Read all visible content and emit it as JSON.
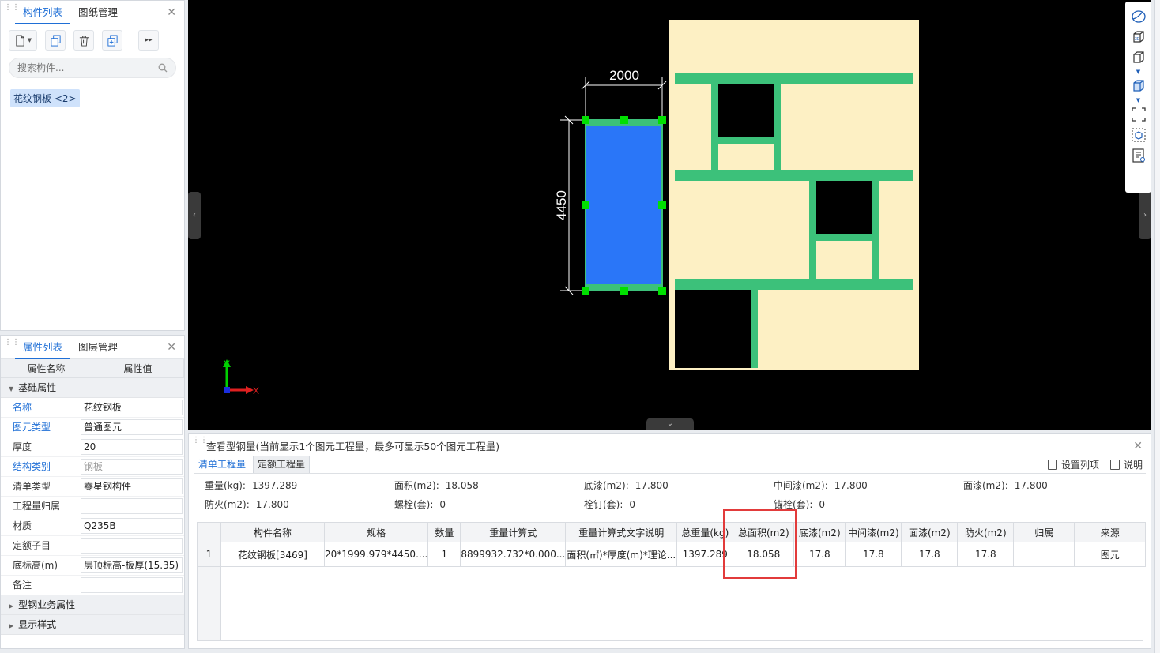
{
  "component_panel": {
    "tabs": [
      "构件列表",
      "图纸管理"
    ],
    "search_placeholder": "搜索构件...",
    "tag": "花纹钢板 <2>"
  },
  "property_panel": {
    "tabs": [
      "属性列表",
      "图层管理"
    ],
    "col_name": "属性名称",
    "col_value": "属性值",
    "group_basic": "基础属性",
    "rows": [
      {
        "k": "名称",
        "v": "花纹钢板"
      },
      {
        "k": "图元类型",
        "v": "普通图元"
      },
      {
        "k": "厚度",
        "v": "20"
      },
      {
        "k": "结构类别",
        "v": "钢板"
      },
      {
        "k": "清单类型",
        "v": "零星钢构件"
      },
      {
        "k": "工程量归属",
        "v": ""
      },
      {
        "k": "材质",
        "v": "Q235B"
      },
      {
        "k": "定额子目",
        "v": ""
      },
      {
        "k": "底标高(m)",
        "v": "层顶标高-板厚(15.35)"
      },
      {
        "k": "备注",
        "v": ""
      }
    ],
    "group_business": "型钢业务属性",
    "group_display": "显示样式"
  },
  "canvas": {
    "dim_width": "2000",
    "dim_height": "4450",
    "axis_y": "Y",
    "axis_x": "X",
    "colors": {
      "plate": "#2a76f8",
      "handle": "#00e000",
      "beam": "#3cc17a",
      "floor": "#fdf0c4"
    }
  },
  "bottom_panel": {
    "title": "查看型钢量(当前显示1个图元工程量，最多可显示50个图元工程量)",
    "tabs": [
      "清单工程量",
      "定额工程量"
    ],
    "actions": [
      "设置列项",
      "说明"
    ],
    "summary": [
      {
        "label": "重量(kg):",
        "value": "1397.289"
      },
      {
        "label": "面积(m2):",
        "value": "18.058"
      },
      {
        "label": "底漆(m2):",
        "value": "17.800"
      },
      {
        "label": "中间漆(m2):",
        "value": "17.800"
      },
      {
        "label": "面漆(m2):",
        "value": "17.800"
      },
      {
        "label": "防火(m2):",
        "value": "17.800"
      },
      {
        "label": "螺栓(套):",
        "value": "0"
      },
      {
        "label": "栓钉(套):",
        "value": "0"
      },
      {
        "label": "锚栓(套):",
        "value": "0"
      }
    ],
    "table": {
      "headers": [
        "构件名称",
        "规格",
        "数量",
        "重量计算式",
        "重量计算式文字说明",
        "总重量(kg)",
        "总面积(m2)",
        "底漆(m2)",
        "中间漆(m2)",
        "面漆(m2)",
        "防火(m2)",
        "归属",
        "来源"
      ],
      "rows": [
        [
          "1",
          "花纹钢板[3469]",
          "20*1999.979*4450....",
          "1",
          "8899932.732*0.000...",
          "面积(㎡)*厚度(m)*理论...",
          "1397.289",
          "18.058",
          "17.8",
          "17.8",
          "17.8",
          "17.8",
          "",
          "图元"
        ]
      ]
    }
  }
}
